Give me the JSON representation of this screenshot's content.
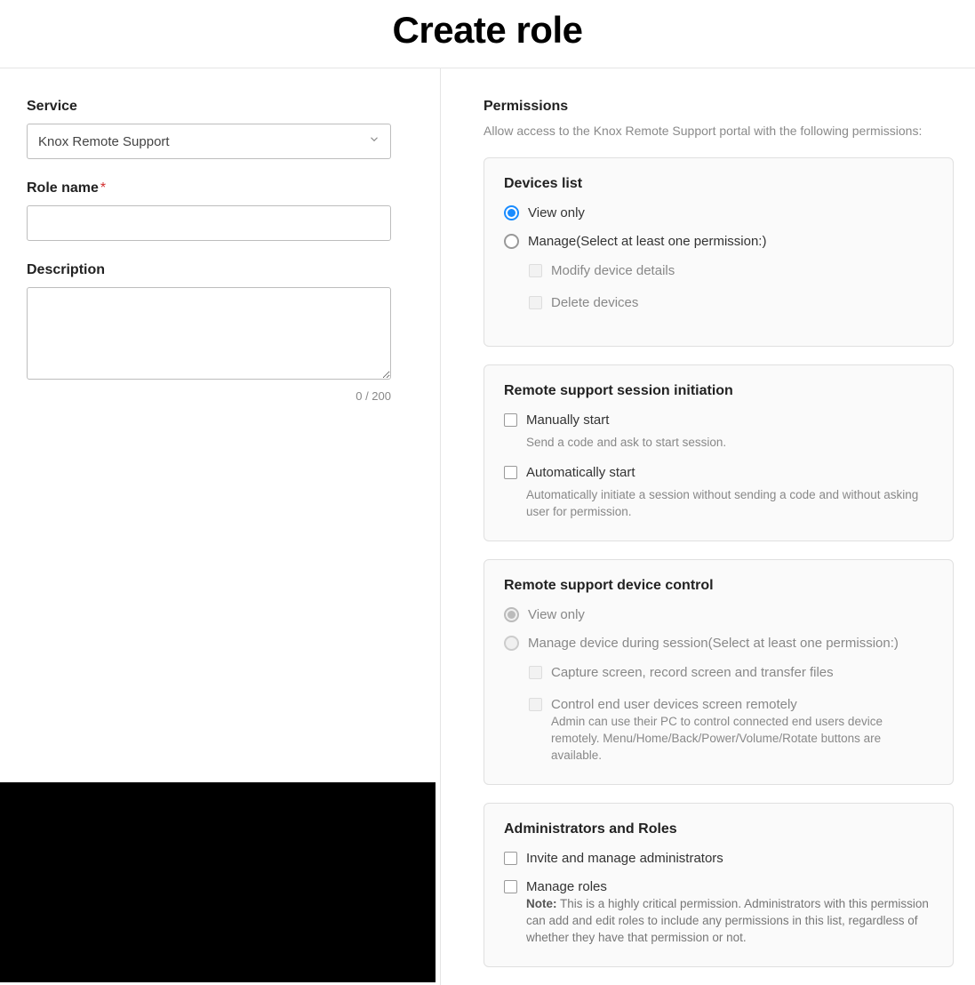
{
  "page_title": "Create role",
  "left": {
    "service_label": "Service",
    "service_value": "Knox Remote Support",
    "role_name_label": "Role name",
    "role_name_value": "",
    "description_label": "Description",
    "description_value": "",
    "char_count": "0 / 200"
  },
  "right": {
    "heading": "Permissions",
    "subtext": "Allow access to the Knox Remote Support portal with the following permissions:",
    "cards": {
      "devices": {
        "title": "Devices list",
        "view_only": "View only",
        "manage": "Manage(Select at least one permission:)",
        "modify": "Modify device details",
        "delete": "Delete devices"
      },
      "session": {
        "title": "Remote support session initiation",
        "manual": "Manually start",
        "manual_desc": "Send a code and ask to start session.",
        "auto": "Automatically start",
        "auto_desc": "Automatically initiate a session without sending a code and without asking user for permission."
      },
      "control": {
        "title": "Remote support device control",
        "view_only": "View only",
        "manage": "Manage device during session(Select at least one permission:)",
        "capture": "Capture screen, record screen and transfer files",
        "remote": "Control end user devices screen remotely",
        "remote_desc": "Admin can use their PC to control connected end users device remotely. Menu/Home/Back/Power/Volume/Rotate buttons are available."
      },
      "admins": {
        "title": "Administrators and Roles",
        "invite": "Invite and manage administrators",
        "manage_roles": "Manage roles",
        "note_label": "Note:",
        "note_body": " This is a highly critical permission. Administrators with this permission can add and edit roles to include any permissions in this list, regardless of whether they have that permission or not."
      }
    }
  }
}
